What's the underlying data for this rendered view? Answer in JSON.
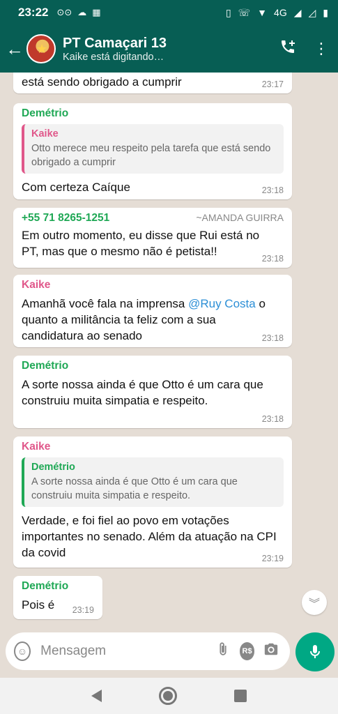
{
  "status_bar": {
    "time": "23:22",
    "network_label": "4G"
  },
  "header": {
    "back_icon": "arrow-left-icon",
    "title": "PT Camaçari 13",
    "subtitle": "Kaike está digitando…",
    "call_icon": "add-call-icon",
    "menu_icon": "more-vertical-icon"
  },
  "messages": [
    {
      "text": "está sendo obrigado a cumprir",
      "time": "23:17"
    },
    {
      "sender": "Demétrio",
      "quote_name": "Kaike",
      "quote_text": "Otto merece meu respeito pela tarefa que está sendo obrigado a cumprir",
      "text": "Com certeza Caíque",
      "time": "23:18"
    },
    {
      "phone": "+55 71 8265-1251",
      "alias": "~AMANDA GUIRRA",
      "text": "Em outro momento, eu disse que Rui está no PT, mas que o mesmo não é petista!!",
      "time": "23:18"
    },
    {
      "sender": "Kaike",
      "text_before": "Amanhã você fala na imprensa ",
      "mention": "@Ruy Costa",
      "text_after": " o quanto a militância ta feliz com a sua candidatura ao senado",
      "time": "23:18"
    },
    {
      "sender": "Demétrio",
      "text": "A sorte nossa ainda é que Otto é um cara que construiu muita simpatia e respeito.",
      "time": "23:18"
    },
    {
      "sender": "Kaike",
      "quote_name": "Demétrio",
      "quote_text": "A sorte nossa ainda é que Otto é um cara que construiu muita simpatia e respeito.",
      "text": "Verdade, e foi fiel ao povo em votações importantes no senado. Além da atuação na CPI da covid",
      "time": "23:19"
    },
    {
      "sender": "Demétrio",
      "text": "Pois é",
      "time": "23:19"
    }
  ],
  "input": {
    "placeholder": "Mensagem",
    "payment_label": "R$"
  },
  "colors": {
    "header": "#075e54",
    "accent": "#00a884",
    "sender_green": "#1fa855",
    "sender_pink": "#e0578a"
  }
}
